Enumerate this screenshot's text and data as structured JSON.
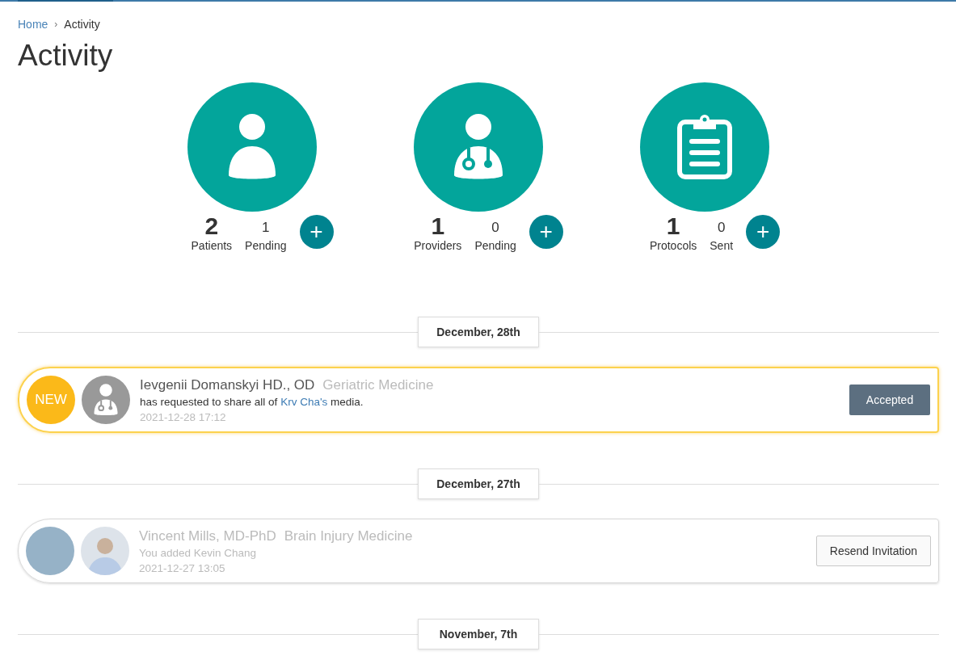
{
  "breadcrumb": [
    {
      "label": "Home",
      "selected": false
    },
    {
      "label": "Activity",
      "selected": true
    }
  ],
  "breadcrumb_separator": "›",
  "title": "Activity",
  "stats": [
    {
      "kind": "patient",
      "count": "2",
      "label": "Patients",
      "sub_count": "1",
      "sub_label": "Pending",
      "add": "+"
    },
    {
      "kind": "provider",
      "count": "1",
      "label": "Providers",
      "sub_count": "0",
      "sub_label": "Pending",
      "add": "+"
    },
    {
      "kind": "protocol",
      "count": "1",
      "label": "Protocols",
      "sub_count": "0",
      "sub_label": "Sent",
      "add": "+"
    }
  ],
  "feed": [
    {
      "date": "December, 28th",
      "items": [
        {
          "new": true,
          "badge": "NEW",
          "kind": "provider",
          "name": "Ievgenii Domanskyi HD., OD",
          "specialty": "Geriatric Medicine",
          "message_before": "has requested to share all of",
          "link": "Krv Cha's",
          "message_after": "media.",
          "time": "2021-12-28 17:12",
          "button": {
            "kind": "primary",
            "label": "Accepted"
          }
        }
      ]
    },
    {
      "date": "December, 27th",
      "items": [
        {
          "new": false,
          "kind": "photo",
          "name": "Vincent Mills, MD-PhD",
          "specialty": "Brain Injury Medicine",
          "message_before": "You added Kevin Chang",
          "time": "2021-12-27 13:05",
          "button": {
            "kind": "secondary",
            "label": "Resend Invitation"
          }
        }
      ]
    },
    {
      "date": "November, 7th"
    }
  ]
}
